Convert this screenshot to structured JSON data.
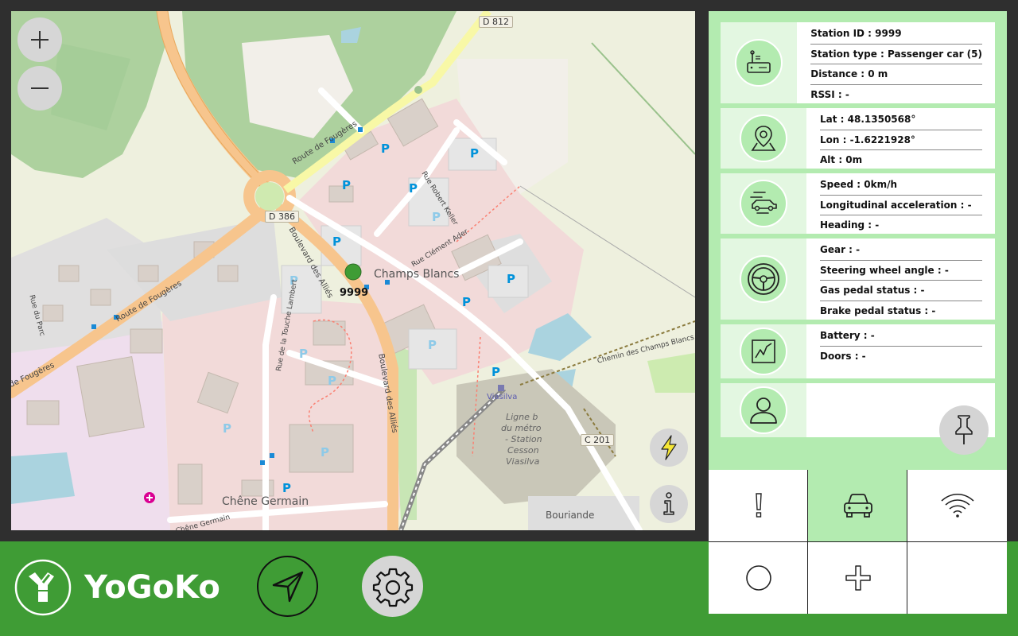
{
  "map": {
    "marker_label": "9999",
    "zoom_in_label": "+",
    "zoom_out_label": "—",
    "labels": {
      "d812": "D 812",
      "d386": "D 386",
      "c201": "C 201",
      "route_fougeres_1": "Route de Fougères",
      "route_fougeres_2": "Route de Fougères",
      "route_fougeres_3": "de Fougères",
      "champs_blancs": "Champs Blancs",
      "chene_germain": "Chêne Germain",
      "bouriande": "Bouriande",
      "viasilva": "Viasilva",
      "ligne_b": "Ligne b",
      "du_metro": "du métro",
      "station": "- Station",
      "cesson": "Cesson",
      "viasilva2": "Viasilva",
      "bd_allies_1": "Boulevard des Alliés",
      "bd_allies_2": "Boulevard des Alliés",
      "rue_robert_keller": "Rue Robert Keller",
      "rue_clement_ader": "Rue Clément Ader",
      "rue_touche_lambert": "Rue de la Touche Lambert",
      "rue_du_parc": "Rue du Parc",
      "chemin_champs_blancs": "Chemin des Champs Blancs",
      "chene_germain_road": "Chêne Germain"
    }
  },
  "panel": {
    "station": {
      "id": "Station ID : 9999",
      "type": "Station type : Passenger car (5)",
      "distance": "Distance : 0 m",
      "rssi": "RSSI : -"
    },
    "position": {
      "lat": "Lat : 48.1350568°",
      "lon": "Lon : -1.6221928°",
      "alt": "Alt : 0m"
    },
    "motion": {
      "speed": "Speed : 0km/h",
      "accel": "Longitudinal acceleration : -",
      "heading": "Heading : -"
    },
    "driving": {
      "gear": "Gear : -",
      "steering": "Steering wheel angle : -",
      "gas": "Gas pedal status : -",
      "brake": "Brake pedal status : -"
    },
    "status": {
      "battery": "Battery : -",
      "doors": "Doors : -"
    }
  },
  "brand": {
    "name": "YoGoKo"
  },
  "colors": {
    "brand_green": "#3f9c35",
    "panel_green": "#b3ebb0",
    "marker_green": "#3f9c35"
  }
}
